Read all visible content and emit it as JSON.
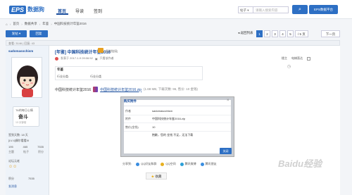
{
  "header": {
    "logo_badge": "EPS",
    "logo_name": "数据狗",
    "nav": [
      "首页",
      "导读",
      "签到"
    ],
    "search_type": "帖子",
    "search_placeholder": "请输入搜索内容",
    "search_icon": "search-icon",
    "data_button": "EPS数据平台"
  },
  "breadcrumb": [
    "首页",
    "数据共享",
    "年鉴",
    "中国科技统计年鉴2016"
  ],
  "toolbar": {
    "new_post": "发帖 ▾",
    "reply": "回复",
    "back": "◂ 返回列表",
    "pages": [
      "1",
      "2",
      "3",
      "4",
      "5"
    ],
    "current_page": "1",
    "page_input": "/ 5 页",
    "next": "下一页"
  },
  "stats_bar": "查看: 3146 | 回复: 43",
  "user": {
    "name": "sadomasochism",
    "sign_label": "TA的每日心情",
    "mood": "奋斗",
    "sign_date": "13 分钟前",
    "sign_days": "签到天数: 18 天",
    "level": "[LV.4]偶尔看看III",
    "stats": [
      "195",
      "465",
      "7535"
    ],
    "stats_labels": [
      "主题",
      "帖子",
      "积分"
    ],
    "mood_label": "论坛元老",
    "points_label": "积分",
    "points_value": "7535",
    "send_msg": "发消息"
  },
  "post": {
    "tag": "[年鉴]",
    "title": "中国科技统计年鉴2016",
    "title_sub": "[复制链接]",
    "author_line": "发表于 2017-1-9 09:06:52",
    "only_author": "只看该作者",
    "right_links": [
      "楼主",
      "电梯直达"
    ],
    "attr_heading": "年鉴",
    "attr_label": "行业分类:",
    "attr_value": "行业分类",
    "file_title": "中国科技统计年鉴2016",
    "file_name": "中国科技统计年鉴2016.zip",
    "file_info": "(1.68 MB, 下载次数: 96, 售价: 10 金钱)"
  },
  "share": {
    "label": "分享到:",
    "items": [
      "QQ好友和群",
      "QQ空间",
      "腾讯微博",
      "腾讯朋友"
    ],
    "colors": [
      "#3a8de0",
      "#e8b020",
      "#2ca0d8",
      "#3a8de0"
    ],
    "favorite": "收藏"
  },
  "modal": {
    "title": "购买附件",
    "close": "×",
    "rows": [
      {
        "label": "作者",
        "value": "sadomasochism"
      },
      {
        "label": "附件",
        "value": "中国科技统计年鉴2016.zip"
      },
      {
        "label": "售价(金钱)",
        "value": "10"
      },
      {
        "label": "",
        "value": "抱歉，您的 金钱 不足，无法下载"
      }
    ],
    "ok": "关闭"
  },
  "watermark": "Baidu经验"
}
